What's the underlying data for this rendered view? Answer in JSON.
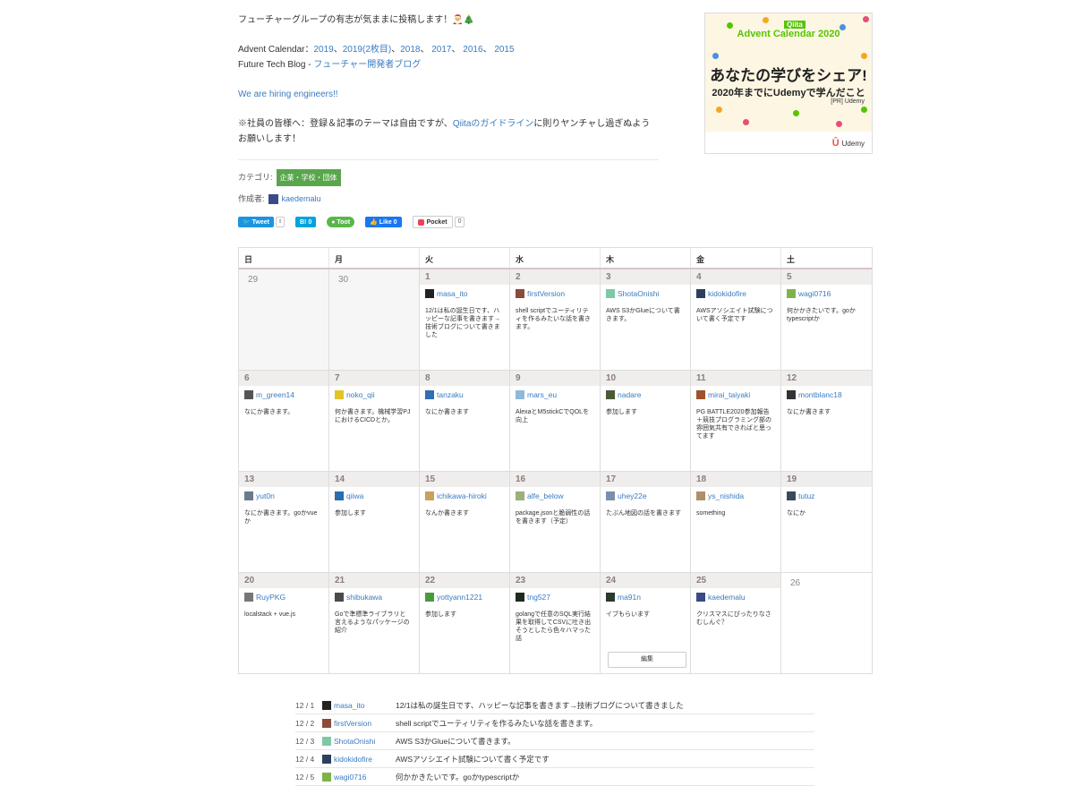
{
  "intro": {
    "tagline": "フューチャーグループの有志が気ままに投稿します！🎅🎄",
    "advent_label": "Advent Calendar：",
    "advent_years": [
      "2019",
      "2019(2枚目)",
      "2018",
      "2017",
      "2016",
      "2015"
    ],
    "blog_label": "Future Tech Blog - ",
    "blog_link": "フューチャー開発者ブログ",
    "hiring": "We are hiring engineers!!",
    "note_before": "※社員の皆様へ：登録＆記事のテーマは自由ですが、",
    "note_link": "Qiitaのガイドライン",
    "note_after": "に則りヤンチャし過ぎぬようお願いします！"
  },
  "meta": {
    "category_label": "カテゴリ:",
    "category": "企業・学校・団体",
    "author_label": "作成者:",
    "author": "kaedemalu"
  },
  "share": {
    "tweet": "Tweet",
    "hatena": "B! 0",
    "mastodon": "Toot",
    "like": "Like 0",
    "pocket": "Pocket",
    "pocket_count": "0"
  },
  "ad": {
    "badge": "Qiita",
    "title": "Advent Calendar 2020",
    "main": "あなたの学びをシェア!",
    "sub": "2020年までにUdemyで学んだこと",
    "pr": "[PR] Udemy",
    "logo": "Udemy"
  },
  "calendar": {
    "weekdays": [
      "日",
      "月",
      "火",
      "水",
      "木",
      "金",
      "土"
    ],
    "edit_label": "編集",
    "weeks": [
      [
        {
          "day": "29",
          "empty": true
        },
        {
          "day": "30",
          "empty": true
        },
        {
          "day": "1",
          "user": "masa_ito",
          "desc": "12/1は私の誕生日です、ハッピーな記事を書きます→技術ブログについて書きました",
          "color": "#222222"
        },
        {
          "day": "2",
          "user": "firstVersion",
          "desc": "shell scriptでユーティリティを作るみたいな話を書きます。",
          "color": "#8b4a3a"
        },
        {
          "day": "3",
          "user": "ShotaOnishi",
          "desc": "AWS S3かGlueについて書きます。",
          "color": "#7cc9a4"
        },
        {
          "day": "4",
          "user": "kidokidofire",
          "desc": "AWSアソシエイト試験について書く予定です",
          "color": "#2d3f5e"
        },
        {
          "day": "5",
          "user": "wagi0716",
          "desc": "何かかきたいです。goかtypescriptか",
          "color": "#7fb34a"
        }
      ],
      [
        {
          "day": "6",
          "user": "m_green14",
          "desc": "なにか書きます。",
          "color": "#555555"
        },
        {
          "day": "7",
          "user": "noko_qii",
          "desc": "何か書きます。機械学習PJにおけるCICDとか。",
          "color": "#e2c428"
        },
        {
          "day": "8",
          "user": "tanzaku",
          "desc": "なにか書きます",
          "color": "#2e6fb5"
        },
        {
          "day": "9",
          "user": "mars_eu",
          "desc": "AlexaとM5stickCでQOLを向上",
          "color": "#8fb9d9"
        },
        {
          "day": "10",
          "user": "nadare",
          "desc": "参加します",
          "color": "#4d5a3a"
        },
        {
          "day": "11",
          "user": "mirai_taiyaki",
          "desc": "PG BATTLE2020参加報告＋競技プログラミング部の雰囲気共有できればと思ってます",
          "color": "#a0522d"
        },
        {
          "day": "12",
          "user": "montblanc18",
          "desc": "なにか書きます",
          "color": "#333333"
        }
      ],
      [
        {
          "day": "13",
          "user": "yut0n",
          "desc": "なにか書きます。goかvueか",
          "color": "#6b7b8c"
        },
        {
          "day": "14",
          "user": "qiiwa",
          "desc": "参加します",
          "color": "#2a6db0"
        },
        {
          "day": "15",
          "user": "ichikawa-hiroki",
          "desc": "なんか書きます",
          "color": "#c9a15b"
        },
        {
          "day": "16",
          "user": "alfe_below",
          "desc": "package.jsonと脆弱性の話を書きます（予定）",
          "color": "#9bb07a"
        },
        {
          "day": "17",
          "user": "uhey22e",
          "desc": "たぶん地図の話を書きます",
          "color": "#7a8fb0"
        },
        {
          "day": "18",
          "user": "ys_nishida",
          "desc": "something",
          "color": "#b08f6a"
        },
        {
          "day": "19",
          "user": "tutuz",
          "desc": "なにか",
          "color": "#3a4a5a"
        }
      ],
      [
        {
          "day": "20",
          "user": "RuyPKG",
          "desc": "localstack + vue.js",
          "color": "#777777"
        },
        {
          "day": "21",
          "user": "shibukawa",
          "desc": "Goで準標準ライブラリと言えるようなパッケージの紹介",
          "color": "#4a4a4a"
        },
        {
          "day": "22",
          "user": "yottyann1221",
          "desc": "参加します",
          "color": "#4a9a3a"
        },
        {
          "day": "23",
          "user": "tng527",
          "desc": "golangで任意のSQL実行結果を取得してCSVに吐き出そうとしたら色々ハマった話",
          "color": "#1e2a1e"
        },
        {
          "day": "24",
          "user": "ma91n",
          "desc": "イブもらいます",
          "color": "#2b3a2b",
          "edit": true
        },
        {
          "day": "25",
          "user": "kaedemalu",
          "desc": "クリスマスにぴったりなさむしんぐ？",
          "color": "#3b4a86"
        },
        {
          "day": "26",
          "plain": true
        }
      ]
    ]
  },
  "entries": [
    {
      "date": "12 / 1",
      "user": "masa_ito",
      "title": "12/1は私の誕生日です、ハッピーな記事を書きます→技術ブログについて書きました",
      "color": "#222222"
    },
    {
      "date": "12 / 2",
      "user": "firstVersion",
      "title": "shell scriptでユーティリティを作るみたいな話を書きます。",
      "color": "#8b4a3a"
    },
    {
      "date": "12 / 3",
      "user": "ShotaOnishi",
      "title": "AWS S3かGlueについて書きます。",
      "color": "#7cc9a4"
    },
    {
      "date": "12 / 4",
      "user": "kidokidofire",
      "title": "AWSアソシエイト試験について書く予定です",
      "color": "#2d3f5e"
    },
    {
      "date": "12 / 5",
      "user": "wagi0716",
      "title": "何かかきたいです。goかtypescriptか",
      "color": "#7fb34a"
    }
  ]
}
